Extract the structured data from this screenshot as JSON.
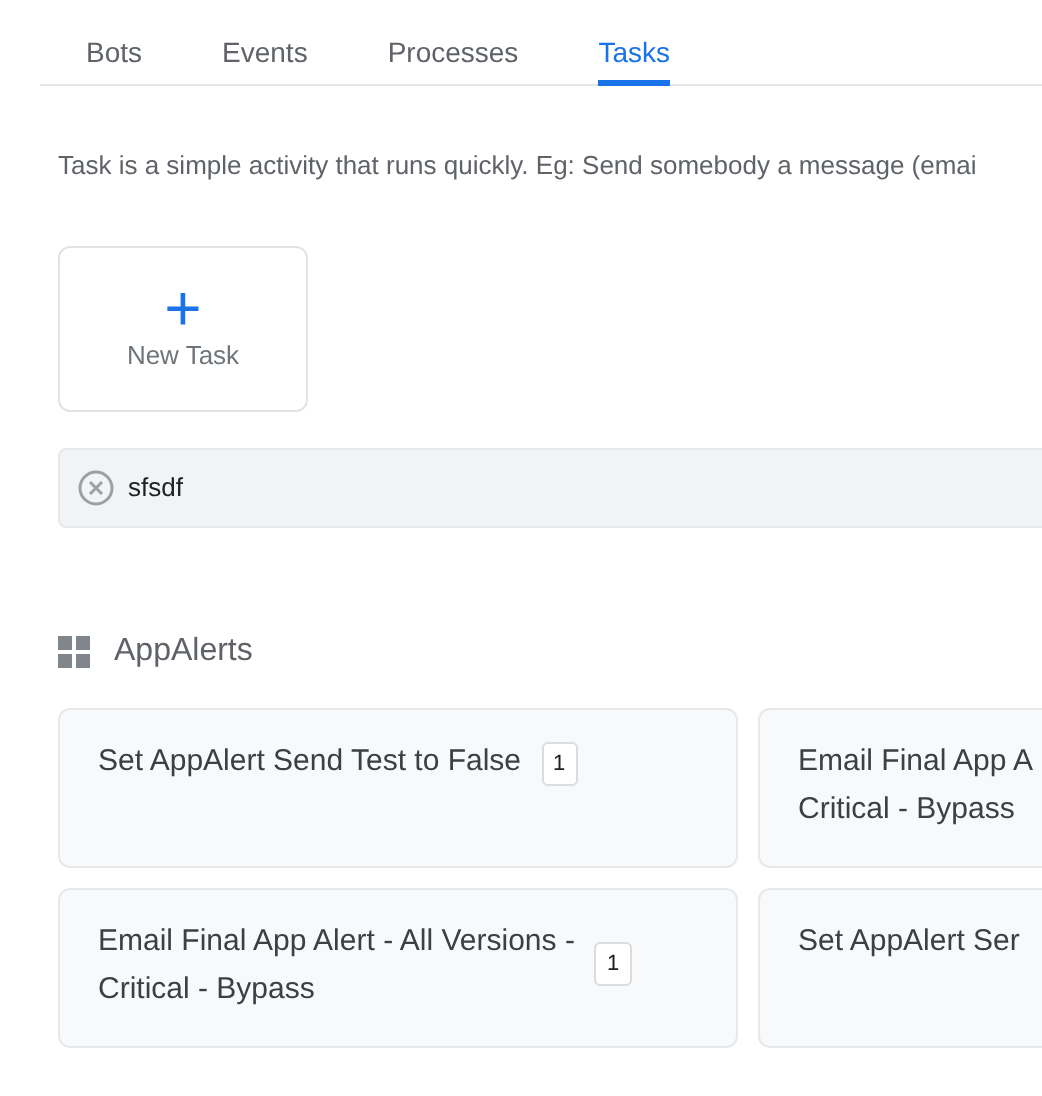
{
  "tabs": [
    {
      "label": "Bots",
      "selected": false
    },
    {
      "label": "Events",
      "selected": false
    },
    {
      "label": "Processes",
      "selected": false
    },
    {
      "label": "Tasks",
      "selected": true
    }
  ],
  "description": "Task is a simple activity that runs quickly. Eg: Send somebody a message (emai",
  "new_task": {
    "icon": "+",
    "label": "New Task"
  },
  "search": {
    "value": "sfsdf"
  },
  "group": {
    "title": "AppAlerts"
  },
  "tasks": [
    {
      "lines": [
        "Set AppAlert Send Test to False"
      ],
      "count": "1"
    },
    {
      "lines": [
        "Email Final App A",
        "Critical - Bypass"
      ]
    },
    {
      "lines": [
        "Email Final App Alert - All Versions -",
        "Critical - Bypass"
      ],
      "count": "1"
    },
    {
      "lines": [
        "Set AppAlert Ser"
      ]
    }
  ]
}
